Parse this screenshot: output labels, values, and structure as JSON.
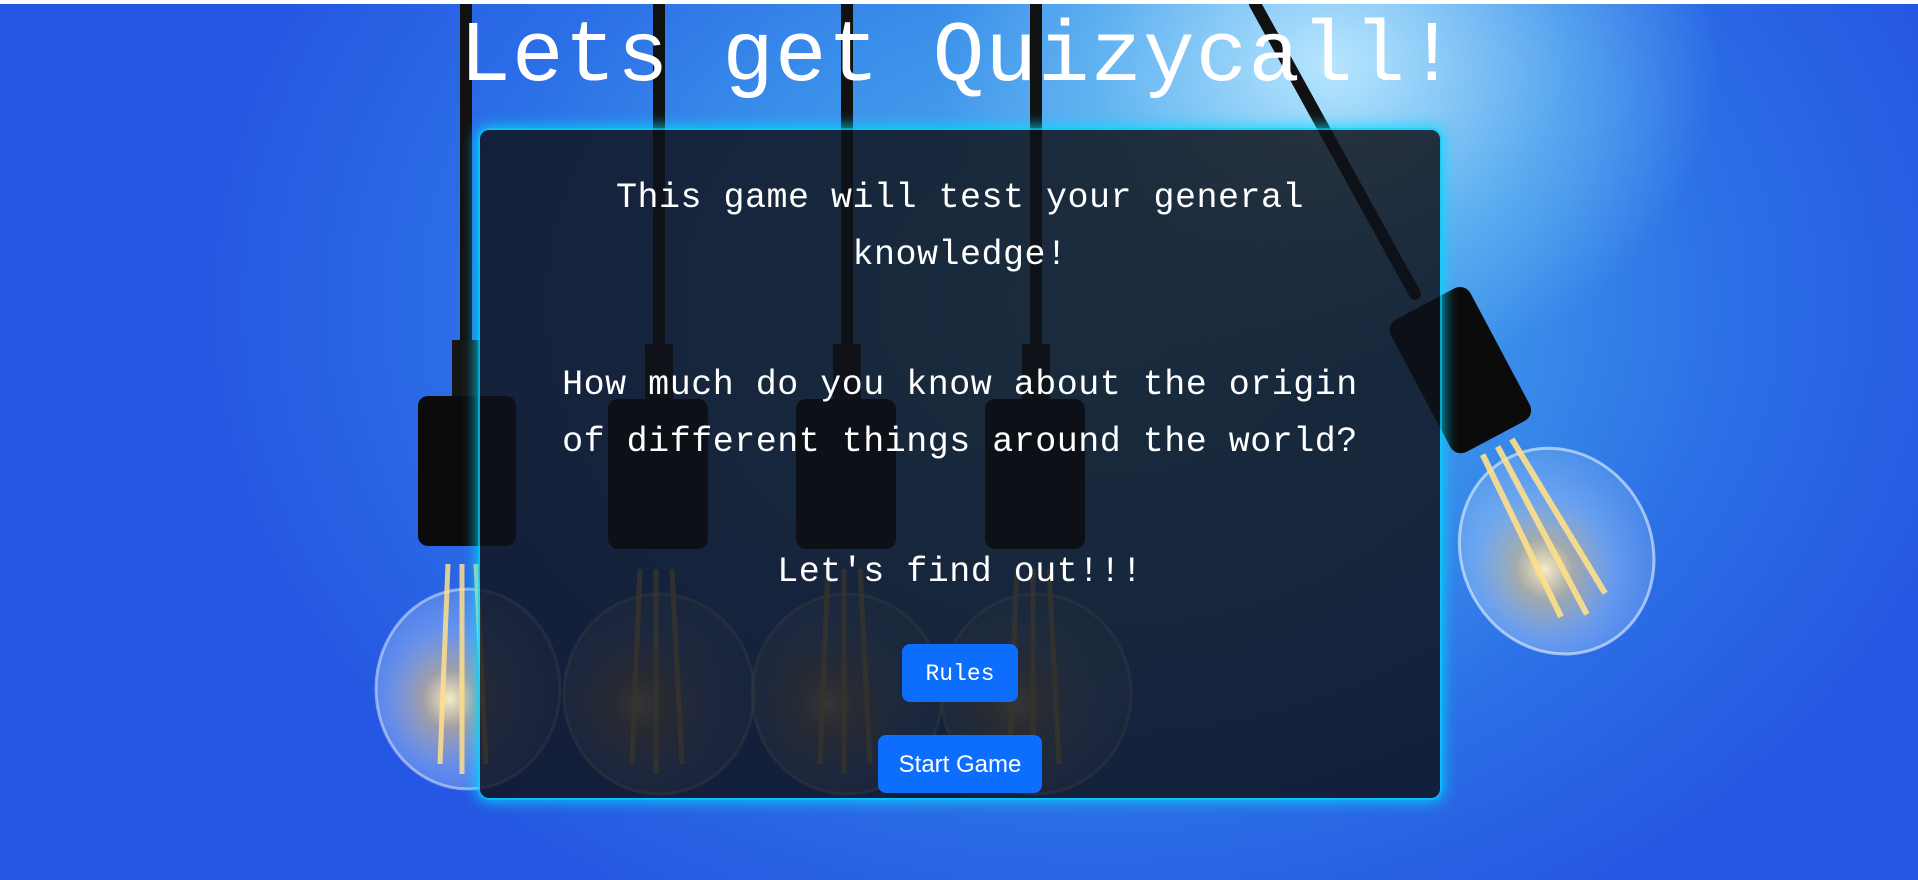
{
  "header": {
    "title": "Lets get Quizycall!"
  },
  "intro": {
    "line1": "This game will test your general knowledge!",
    "line2": "How much do you know about the origin of different things around the world?",
    "line3": "Let's find out!!!"
  },
  "buttons": {
    "rules_label": "Rules",
    "start_label": "Start Game"
  },
  "colors": {
    "button": "#0d6efd",
    "card_glow": "#00dcff",
    "background": "#2c6fe6"
  },
  "background_image": "light-bulbs-icon"
}
